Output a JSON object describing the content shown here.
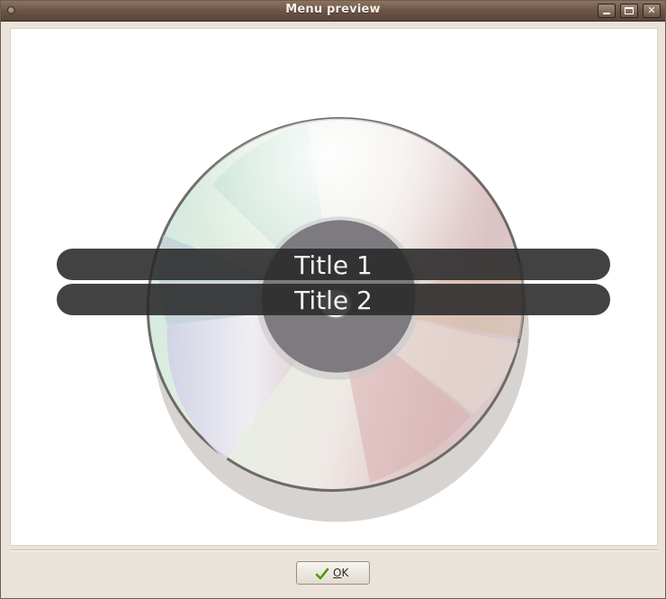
{
  "window": {
    "title": "Menu preview"
  },
  "title_buttons": [
    "minimize-icon",
    "maximize-icon",
    "close-icon"
  ],
  "menu": {
    "items": [
      {
        "label": "Title 1"
      },
      {
        "label": "Title 2"
      }
    ]
  },
  "footer": {
    "ok_button": {
      "mnemonic": "O",
      "rest": "K",
      "icon": "checkmark-icon"
    }
  },
  "colors": {
    "titlebar": "#6c5545",
    "menu_highlight": "#282828",
    "window_bg": "#e9e3da"
  }
}
